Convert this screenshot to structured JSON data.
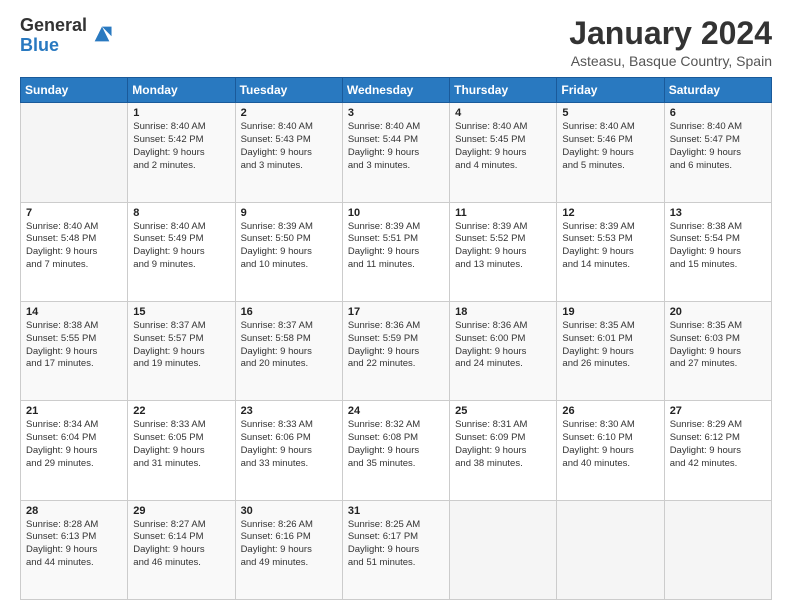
{
  "header": {
    "logo_general": "General",
    "logo_blue": "Blue",
    "title": "January 2024",
    "subtitle": "Asteasu, Basque Country, Spain"
  },
  "calendar": {
    "days": [
      "Sunday",
      "Monday",
      "Tuesday",
      "Wednesday",
      "Thursday",
      "Friday",
      "Saturday"
    ],
    "weeks": [
      [
        {
          "date": "",
          "info": ""
        },
        {
          "date": "1",
          "info": "Sunrise: 8:40 AM\nSunset: 5:42 PM\nDaylight: 9 hours\nand 2 minutes."
        },
        {
          "date": "2",
          "info": "Sunrise: 8:40 AM\nSunset: 5:43 PM\nDaylight: 9 hours\nand 3 minutes."
        },
        {
          "date": "3",
          "info": "Sunrise: 8:40 AM\nSunset: 5:44 PM\nDaylight: 9 hours\nand 3 minutes."
        },
        {
          "date": "4",
          "info": "Sunrise: 8:40 AM\nSunset: 5:45 PM\nDaylight: 9 hours\nand 4 minutes."
        },
        {
          "date": "5",
          "info": "Sunrise: 8:40 AM\nSunset: 5:46 PM\nDaylight: 9 hours\nand 5 minutes."
        },
        {
          "date": "6",
          "info": "Sunrise: 8:40 AM\nSunset: 5:47 PM\nDaylight: 9 hours\nand 6 minutes."
        }
      ],
      [
        {
          "date": "7",
          "info": "Sunrise: 8:40 AM\nSunset: 5:48 PM\nDaylight: 9 hours\nand 7 minutes."
        },
        {
          "date": "8",
          "info": "Sunrise: 8:40 AM\nSunset: 5:49 PM\nDaylight: 9 hours\nand 9 minutes."
        },
        {
          "date": "9",
          "info": "Sunrise: 8:39 AM\nSunset: 5:50 PM\nDaylight: 9 hours\nand 10 minutes."
        },
        {
          "date": "10",
          "info": "Sunrise: 8:39 AM\nSunset: 5:51 PM\nDaylight: 9 hours\nand 11 minutes."
        },
        {
          "date": "11",
          "info": "Sunrise: 8:39 AM\nSunset: 5:52 PM\nDaylight: 9 hours\nand 13 minutes."
        },
        {
          "date": "12",
          "info": "Sunrise: 8:39 AM\nSunset: 5:53 PM\nDaylight: 9 hours\nand 14 minutes."
        },
        {
          "date": "13",
          "info": "Sunrise: 8:38 AM\nSunset: 5:54 PM\nDaylight: 9 hours\nand 15 minutes."
        }
      ],
      [
        {
          "date": "14",
          "info": "Sunrise: 8:38 AM\nSunset: 5:55 PM\nDaylight: 9 hours\nand 17 minutes."
        },
        {
          "date": "15",
          "info": "Sunrise: 8:37 AM\nSunset: 5:57 PM\nDaylight: 9 hours\nand 19 minutes."
        },
        {
          "date": "16",
          "info": "Sunrise: 8:37 AM\nSunset: 5:58 PM\nDaylight: 9 hours\nand 20 minutes."
        },
        {
          "date": "17",
          "info": "Sunrise: 8:36 AM\nSunset: 5:59 PM\nDaylight: 9 hours\nand 22 minutes."
        },
        {
          "date": "18",
          "info": "Sunrise: 8:36 AM\nSunset: 6:00 PM\nDaylight: 9 hours\nand 24 minutes."
        },
        {
          "date": "19",
          "info": "Sunrise: 8:35 AM\nSunset: 6:01 PM\nDaylight: 9 hours\nand 26 minutes."
        },
        {
          "date": "20",
          "info": "Sunrise: 8:35 AM\nSunset: 6:03 PM\nDaylight: 9 hours\nand 27 minutes."
        }
      ],
      [
        {
          "date": "21",
          "info": "Sunrise: 8:34 AM\nSunset: 6:04 PM\nDaylight: 9 hours\nand 29 minutes."
        },
        {
          "date": "22",
          "info": "Sunrise: 8:33 AM\nSunset: 6:05 PM\nDaylight: 9 hours\nand 31 minutes."
        },
        {
          "date": "23",
          "info": "Sunrise: 8:33 AM\nSunset: 6:06 PM\nDaylight: 9 hours\nand 33 minutes."
        },
        {
          "date": "24",
          "info": "Sunrise: 8:32 AM\nSunset: 6:08 PM\nDaylight: 9 hours\nand 35 minutes."
        },
        {
          "date": "25",
          "info": "Sunrise: 8:31 AM\nSunset: 6:09 PM\nDaylight: 9 hours\nand 38 minutes."
        },
        {
          "date": "26",
          "info": "Sunrise: 8:30 AM\nSunset: 6:10 PM\nDaylight: 9 hours\nand 40 minutes."
        },
        {
          "date": "27",
          "info": "Sunrise: 8:29 AM\nSunset: 6:12 PM\nDaylight: 9 hours\nand 42 minutes."
        }
      ],
      [
        {
          "date": "28",
          "info": "Sunrise: 8:28 AM\nSunset: 6:13 PM\nDaylight: 9 hours\nand 44 minutes."
        },
        {
          "date": "29",
          "info": "Sunrise: 8:27 AM\nSunset: 6:14 PM\nDaylight: 9 hours\nand 46 minutes."
        },
        {
          "date": "30",
          "info": "Sunrise: 8:26 AM\nSunset: 6:16 PM\nDaylight: 9 hours\nand 49 minutes."
        },
        {
          "date": "31",
          "info": "Sunrise: 8:25 AM\nSunset: 6:17 PM\nDaylight: 9 hours\nand 51 minutes."
        },
        {
          "date": "",
          "info": ""
        },
        {
          "date": "",
          "info": ""
        },
        {
          "date": "",
          "info": ""
        }
      ]
    ]
  }
}
